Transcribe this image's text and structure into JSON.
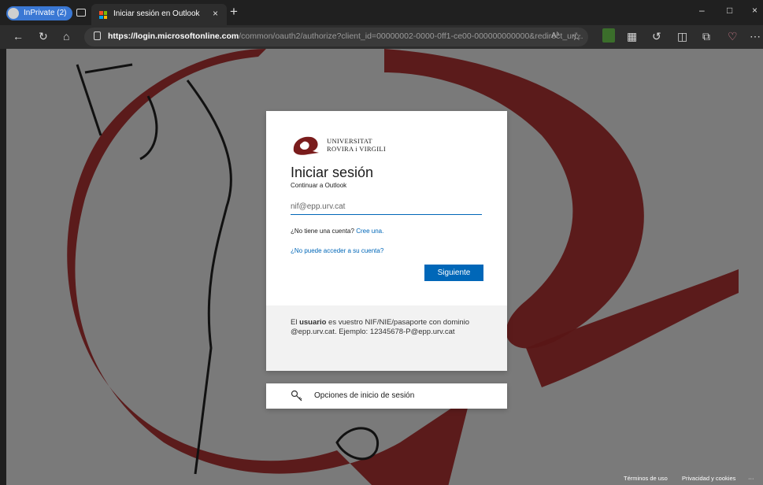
{
  "browser": {
    "inprivate_label": "InPrivate (2)",
    "tab_title": "Iniciar sesión en Outlook",
    "url_host": "https://login.microsoftonline.com",
    "url_path": "/common/oauth2/authorize?client_id=00000002-0000-0ff1-ce00-000000000000&redirect_uri...",
    "read_aloud_label": "Aʰ",
    "new_tab": "+",
    "close_tab": "×",
    "window_controls": [
      "–",
      "□",
      "×"
    ],
    "extensions": [
      "game-extension-icon",
      "calculator-extension-icon",
      "refresh-extension-icon",
      "split-screen-icon",
      "collections-icon",
      "favorites-heart-icon",
      "more-icon"
    ]
  },
  "login": {
    "org_name_line1": "UNIVERSITAT",
    "org_name_line2": "ROVIRA i VIRGILI",
    "title": "Iniciar sesión",
    "subtitle": "Continuar a Outlook",
    "email_placeholder": "nif@epp.urv.cat",
    "no_account_text": "¿No tiene una cuenta?",
    "create_link": "Cree una.",
    "cant_access_link": "¿No puede acceder a su cuenta?",
    "next_button": "Siguiente",
    "info_prefix": "El",
    "info_bold": "usuario",
    "info_rest": "es vuestro NIF/NIE/pasaporte con dominio @epp.urv.cat. Ejemplo: 12345678-P@epp.urv.cat",
    "signin_options": "Opciones de inicio de sesión"
  },
  "footer": {
    "terms": "Términos de uso",
    "privacy": "Privacidad y cookies",
    "more": "···"
  },
  "colors": {
    "accent": "#0067b8",
    "brand_maroon": "#5e1818"
  }
}
